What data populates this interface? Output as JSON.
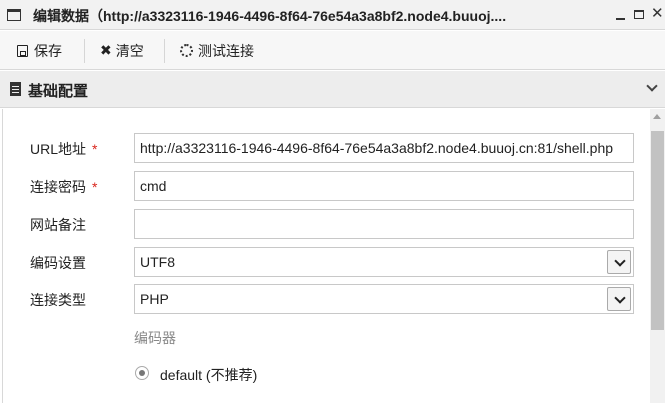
{
  "window": {
    "title": "编辑数据（http://a3323116-1946-4496-8f64-76e54a3a8bf2.node4.buuoj....",
    "close_glyph": "✕"
  },
  "toolbar": {
    "save_label": "保存",
    "clear_label": "清空",
    "test_label": "测试连接"
  },
  "section": {
    "title": "基础配置"
  },
  "form": {
    "url": {
      "label": "URL地址",
      "required_mark": "*",
      "value": "http://a3323116-1946-4496-8f64-76e54a3a8bf2.node4.buuoj.cn:81/shell.php"
    },
    "password": {
      "label": "连接密码",
      "required_mark": "*",
      "value": "cmd"
    },
    "note": {
      "label": "网站备注",
      "value": ""
    },
    "encoding": {
      "label": "编码设置",
      "value": "UTF8"
    },
    "type": {
      "label": "连接类型",
      "value": "PHP"
    },
    "encoder": {
      "label": "编码器",
      "options": [
        {
          "label": "default (不推荐)",
          "checked": true
        }
      ]
    }
  }
}
